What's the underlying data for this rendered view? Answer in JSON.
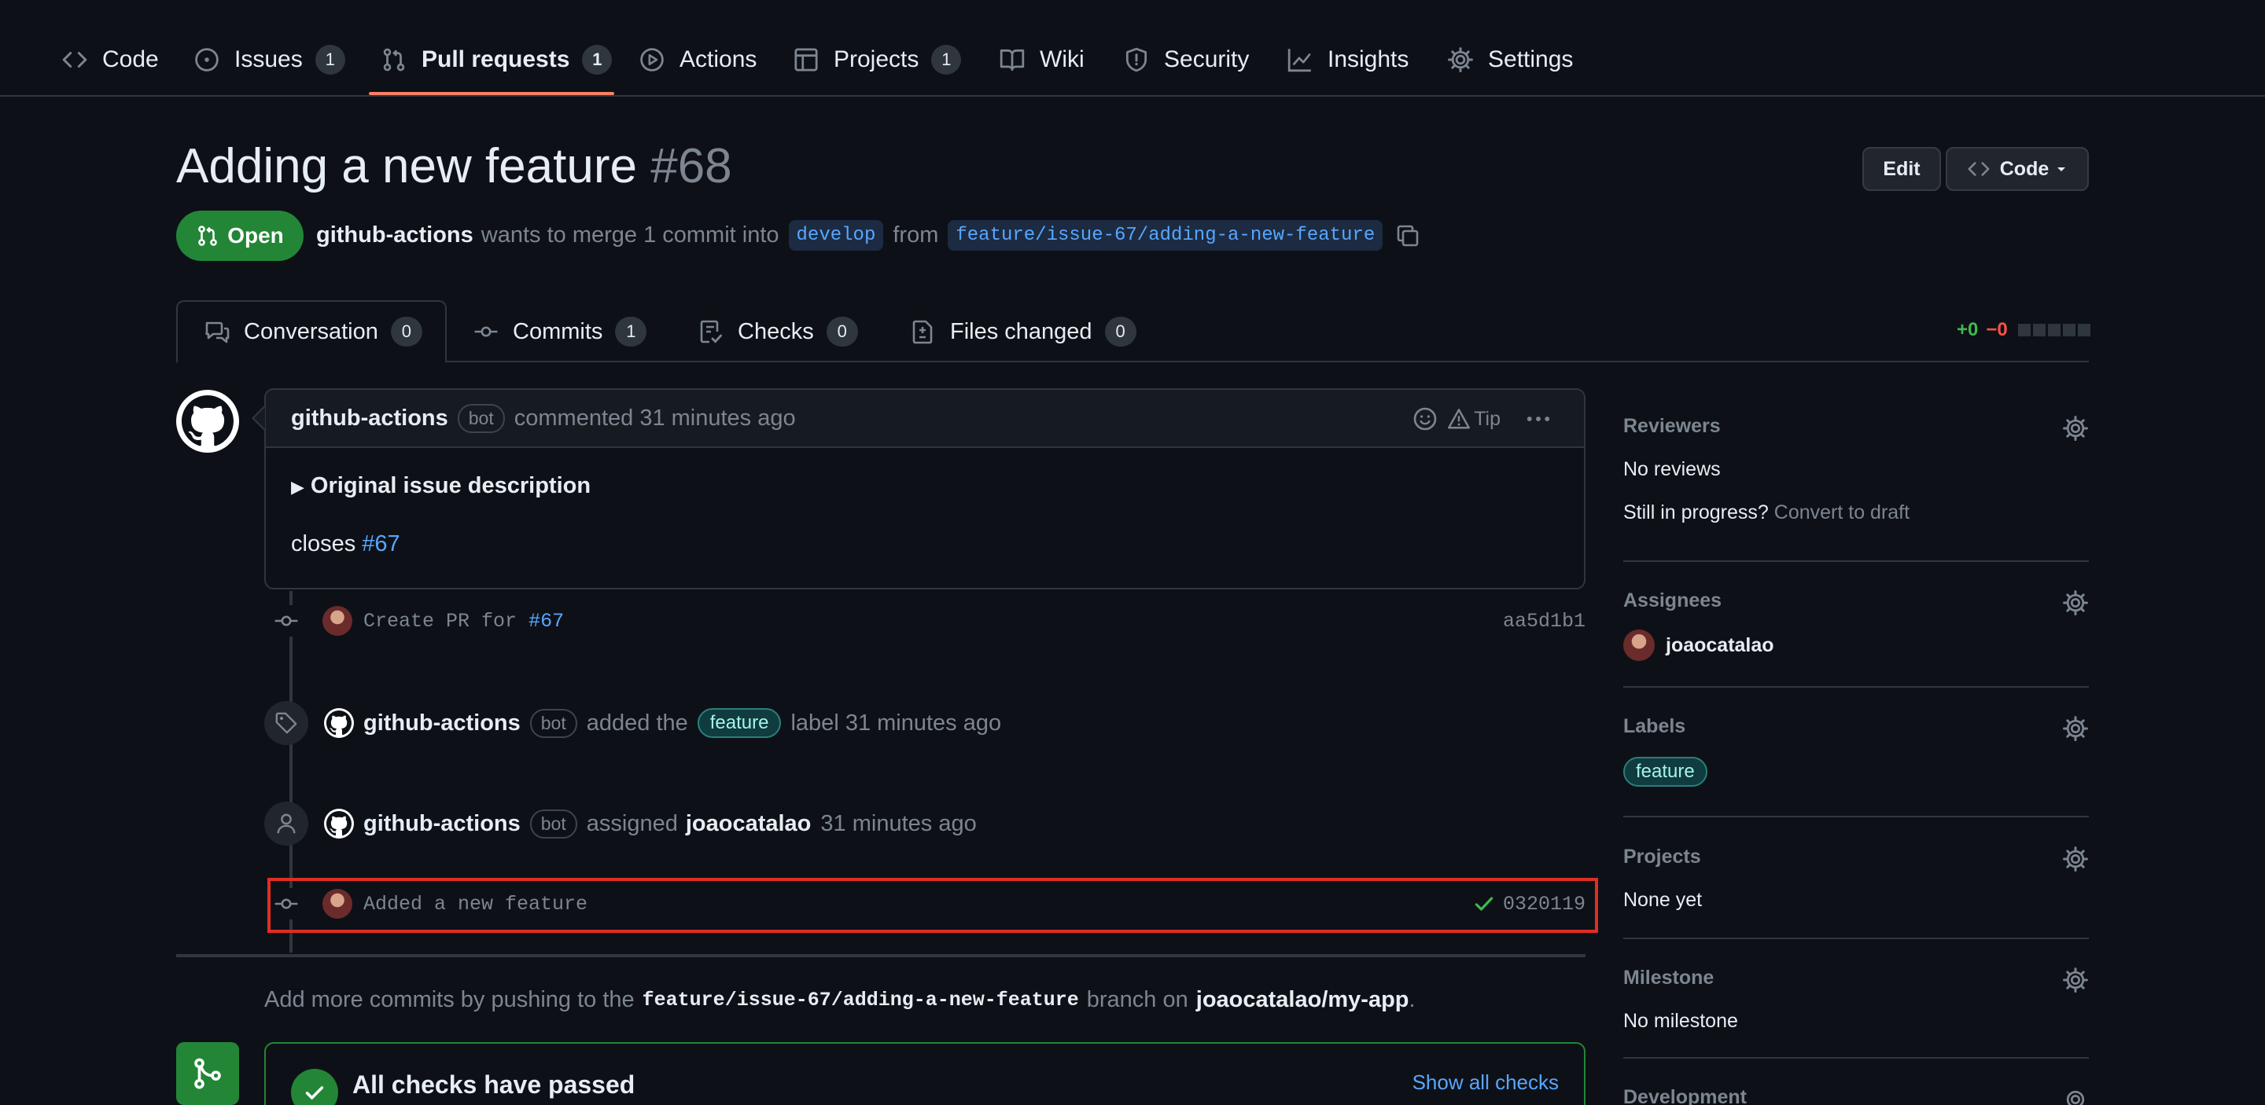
{
  "nav": {
    "code": "Code",
    "issues": "Issues",
    "issues_count": "1",
    "pull_requests": "Pull requests",
    "pull_requests_count": "1",
    "actions": "Actions",
    "projects": "Projects",
    "projects_count": "1",
    "wiki": "Wiki",
    "security": "Security",
    "insights": "Insights",
    "settings": "Settings"
  },
  "header": {
    "title": "Adding a new feature",
    "number": "#68",
    "edit_label": "Edit",
    "code_label": "Code",
    "state": "Open",
    "author": "github-actions",
    "merge_text": "wants to merge 1 commit into",
    "base_branch": "develop",
    "from_text": "from",
    "head_branch": "feature/issue-67/adding-a-new-feature"
  },
  "tabs": {
    "conversation": "Conversation",
    "conversation_count": "0",
    "commits": "Commits",
    "commits_count": "1",
    "checks": "Checks",
    "checks_count": "0",
    "files_changed": "Files changed",
    "files_changed_count": "0",
    "additions": "+0",
    "deletions": "−0"
  },
  "comment": {
    "author": "github-actions",
    "bot_badge": "bot",
    "action": "commented 31 minutes ago",
    "tip": "Tip",
    "summary": "Original issue description",
    "body_prefix": "closes",
    "body_link": "#67"
  },
  "timeline": {
    "commit1_msg_prefix": "Create PR for",
    "commit1_link": "#67",
    "commit1_sha": "aa5d1b1",
    "label_event_author": "github-actions",
    "label_event_bot": "bot",
    "label_event_prefix": "added the",
    "label_event_label": "feature",
    "label_event_suffix": "label 31 minutes ago",
    "assign_event_author": "github-actions",
    "assign_event_bot": "bot",
    "assign_event_prefix": "assigned",
    "assign_event_user": "joaocatalao",
    "assign_event_suffix": "31 minutes ago",
    "commit2_msg": "Added a new feature",
    "commit2_sha": "0320119"
  },
  "footer": {
    "prefix": "Add more commits by pushing to the",
    "branch": "feature/issue-67/adding-a-new-feature",
    "middle": "branch on",
    "repo": "joaocatalao/my-app",
    "suffix": ".",
    "checks_title": "All checks have passed",
    "show_checks": "Show all checks"
  },
  "sidebar": {
    "reviewers_title": "Reviewers",
    "reviewers_value": "No reviews",
    "in_progress": "Still in progress?",
    "convert_draft": "Convert to draft",
    "assignees_title": "Assignees",
    "assignee": "joaocatalao",
    "labels_title": "Labels",
    "label": "feature",
    "projects_title": "Projects",
    "projects_value": "None yet",
    "milestone_title": "Milestone",
    "milestone_value": "No milestone",
    "development_title": "Development"
  },
  "colors": {
    "accent_underline": "#f78166",
    "open_green": "#238636",
    "link_blue": "#58a6ff",
    "highlight_red": "#e02e24"
  }
}
